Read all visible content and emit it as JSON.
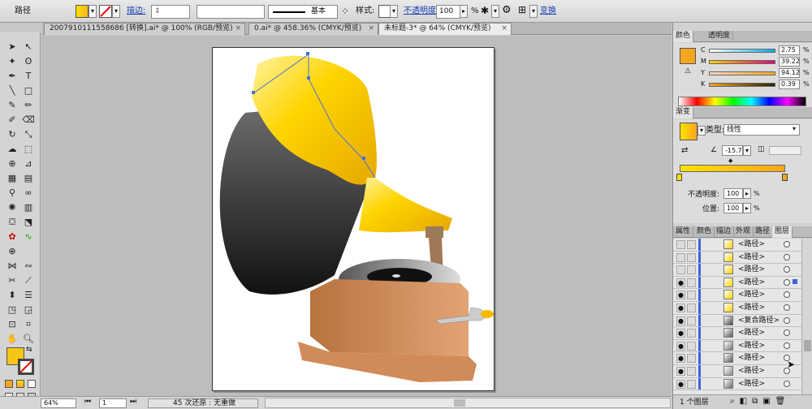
{
  "control_bar": {
    "object_type": "路径",
    "stroke_label": "描边:",
    "stroke_profile": "基本",
    "style_label": "样式:",
    "opacity_label": "不透明度",
    "opacity_value": "100",
    "opacity_unit": "%",
    "transform_link": "变换"
  },
  "tabs": [
    {
      "label": "200791011155868​6 [转换].ai* @ 100% (RGB/预览)",
      "close": "×"
    },
    {
      "label": "0.ai* @ 458.36% (CMYK/预览)",
      "close": "×"
    },
    {
      "label": "未标题-3* @ 64% (CMYK/预览)",
      "close": "×"
    }
  ],
  "color_panel": {
    "tabs": [
      "颜色",
      "透明度"
    ],
    "channels": [
      {
        "label": "C",
        "value": "2.75",
        "unit": "%"
      },
      {
        "label": "M",
        "value": "39.22",
        "unit": "%"
      },
      {
        "label": "Y",
        "value": "94.12",
        "unit": "%"
      },
      {
        "label": "K",
        "value": "0.39",
        "unit": "%"
      }
    ],
    "fill_color": "#f5a61e"
  },
  "gradient_panel": {
    "title": "渐变",
    "type_label": "类型:",
    "type_value": "线性",
    "angle_value": "-15.7",
    "opacity_label": "不透明度:",
    "opacity_value": "100",
    "location_label": "位置:",
    "location_value": "100",
    "unit": "%",
    "start_color": "#ffe100",
    "end_color": "#f5a61e"
  },
  "layers_panel": {
    "tabs": [
      "属性",
      "颜色",
      "描边",
      "外观",
      "路径",
      "图层"
    ],
    "rows": [
      {
        "name": "<路径>"
      },
      {
        "name": "<路径>"
      },
      {
        "name": "<路径>"
      },
      {
        "name": "<路径>"
      },
      {
        "name": "<路径>"
      },
      {
        "name": "<路径>"
      },
      {
        "name": "<复合路径>"
      },
      {
        "name": "<路径>"
      },
      {
        "name": "<路径>"
      },
      {
        "name": "<路径>"
      },
      {
        "name": "<路径>"
      },
      {
        "name": "<路径>"
      }
    ],
    "footer": "1 个图层"
  },
  "status_bar": {
    "zoom": "64%",
    "page": "1",
    "message": "45 次还原 : 无重做"
  },
  "canvas": {
    "artwork_description_colors": {
      "horn_yellow": "#ffd200",
      "horn_gray": "#555555",
      "box": "#c98652",
      "record": "#222222"
    }
  }
}
